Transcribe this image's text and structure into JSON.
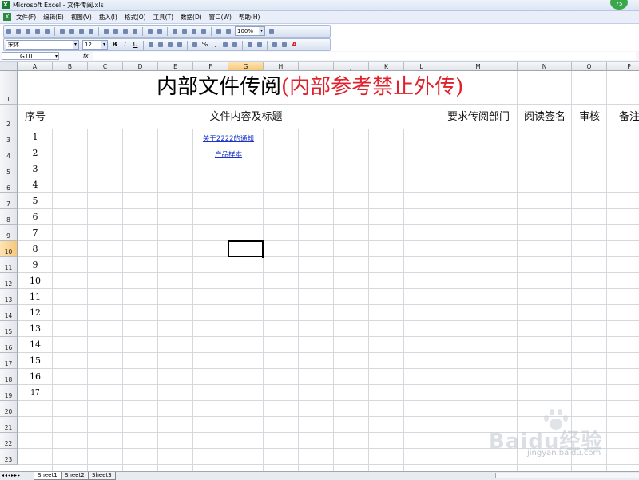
{
  "window": {
    "title": "Microsoft Excel - 文件传阅.xls",
    "badge": "75"
  },
  "menu": {
    "items": [
      "文件(F)",
      "编辑(E)",
      "视图(V)",
      "插入(I)",
      "格式(O)",
      "工具(T)",
      "数据(D)",
      "窗口(W)",
      "帮助(H)"
    ]
  },
  "toolbar": {
    "zoom": "100%",
    "font_name": "宋体",
    "font_size": "12",
    "bold": "B",
    "italic": "I",
    "underline": "U",
    "percent": "%",
    "comma": ",",
    "fontcolor": "A"
  },
  "formula_bar": {
    "name_box": "G10",
    "fx": "fx",
    "content": ""
  },
  "columns": [
    "A",
    "B",
    "C",
    "D",
    "E",
    "F",
    "G",
    "H",
    "I",
    "J",
    "K",
    "L",
    "M",
    "N",
    "O",
    "P"
  ],
  "rows": [
    "1",
    "2",
    "3",
    "4",
    "5",
    "6",
    "7",
    "8",
    "9",
    "10",
    "11",
    "12",
    "13",
    "14",
    "15",
    "16",
    "17",
    "18",
    "19",
    "20",
    "21",
    "22",
    "23"
  ],
  "selection": {
    "column": "G",
    "row": "10"
  },
  "sheet": {
    "title_main": "内部文件传阅",
    "title_red": "(内部参考禁止外传)",
    "headers": {
      "seq": "序号",
      "content": "文件内容及标题",
      "dept": "要求传阅部门",
      "sign": "阅读签名",
      "review": "审核",
      "note": "备注"
    },
    "numbers": [
      "1",
      "2",
      "3",
      "4",
      "5",
      "6",
      "7",
      "8",
      "9",
      "10",
      "11",
      "12",
      "13",
      "14",
      "15",
      "16",
      "17"
    ],
    "links": [
      "关于2222的通知",
      "产品样本"
    ]
  },
  "tabs": {
    "nav": "◂◂◂▸▸▸",
    "sheets": [
      "Sheet1",
      "Sheet2",
      "Sheet3"
    ]
  },
  "watermark": {
    "text": "Baidu经验",
    "sub": "jingyan.baidu.com"
  }
}
